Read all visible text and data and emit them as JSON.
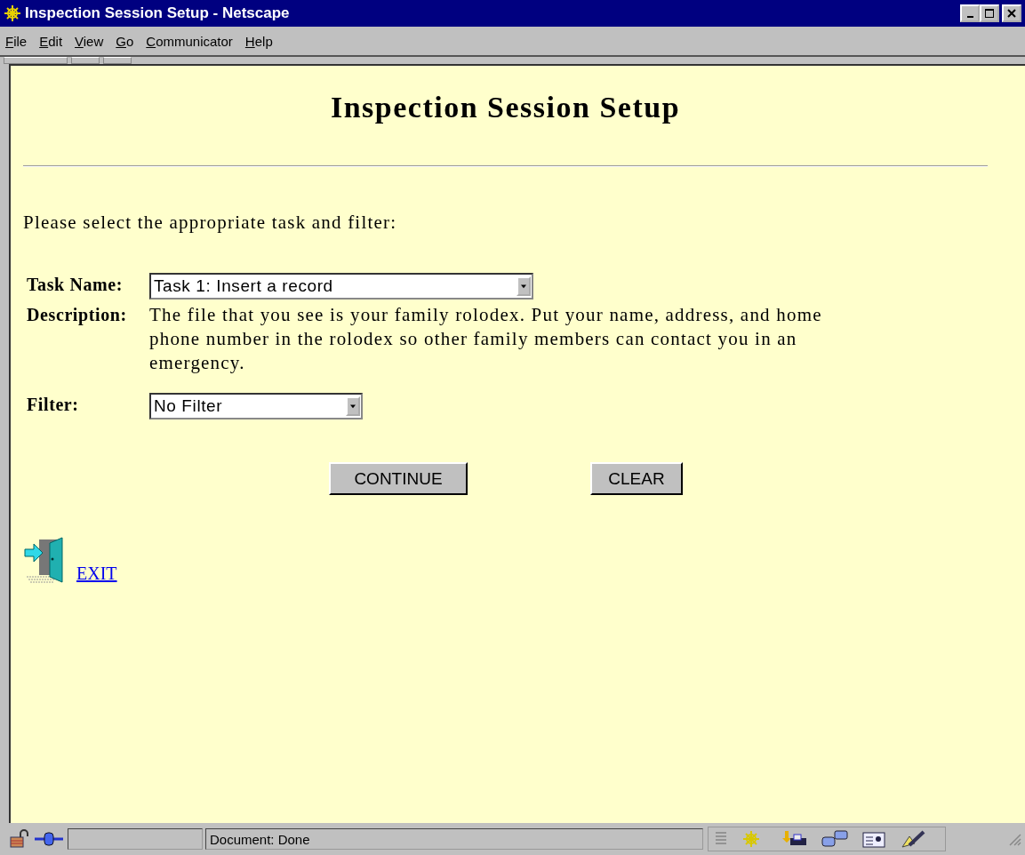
{
  "window": {
    "title": "Inspection Session Setup - Netscape"
  },
  "menu": [
    "File",
    "Edit",
    "View",
    "Go",
    "Communicator",
    "Help"
  ],
  "page": {
    "heading": "Inspection Session Setup",
    "instruction": "Please select the appropriate task and filter:",
    "form": [
      {
        "kind": "select",
        "label": "Task Name:",
        "value": "Task 1: Insert a record"
      },
      {
        "kind": "text",
        "label": "Description:",
        "value": "The file that you see is your family rolodex. Put your name, address, and home phone number in the rolodex so other family members can contact you in an emergency."
      },
      {
        "kind": "select",
        "label": "Filter:",
        "value": "No Filter"
      }
    ],
    "buttons": [
      "CONTINUE",
      "CLEAR"
    ],
    "exit_link": "EXIT"
  },
  "status_bar": {
    "text": "Document: Done"
  }
}
